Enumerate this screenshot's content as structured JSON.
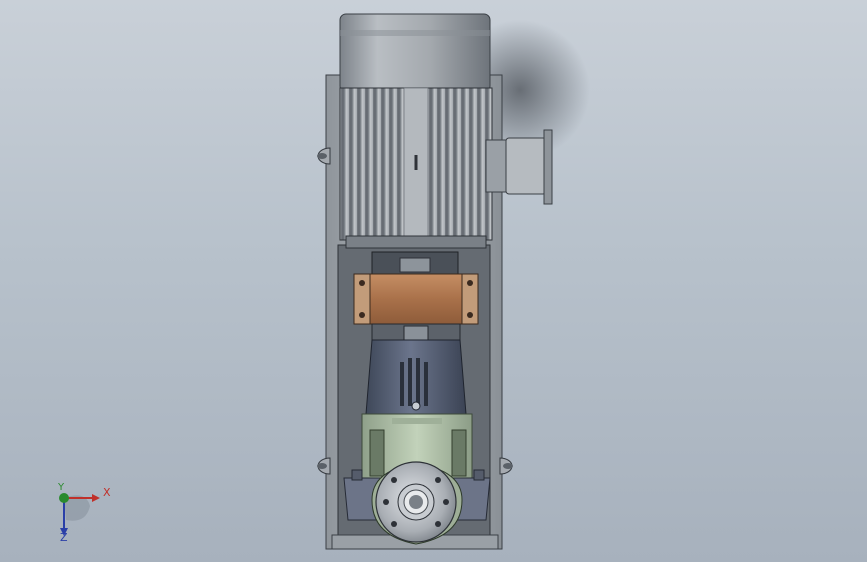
{
  "viewport": {
    "background_top": "#c9d0d8",
    "background_bottom": "#a7b1bd"
  },
  "model": {
    "description_colors": {
      "motor": "#9ea4aa",
      "motor_dark": "#5a5f66",
      "frame": "#a6abb1",
      "coupling_guard": "#b07a52",
      "pump_bracket": "#4e586e",
      "pump_casing": "#aebfa6",
      "volute": "#7a8296"
    }
  },
  "triad": {
    "x_label": "X",
    "y_label": "Y",
    "z_label": "Z",
    "colors": {
      "x": "#c0302a",
      "y": "#2a8a2e",
      "z": "#2a3fa8"
    }
  }
}
